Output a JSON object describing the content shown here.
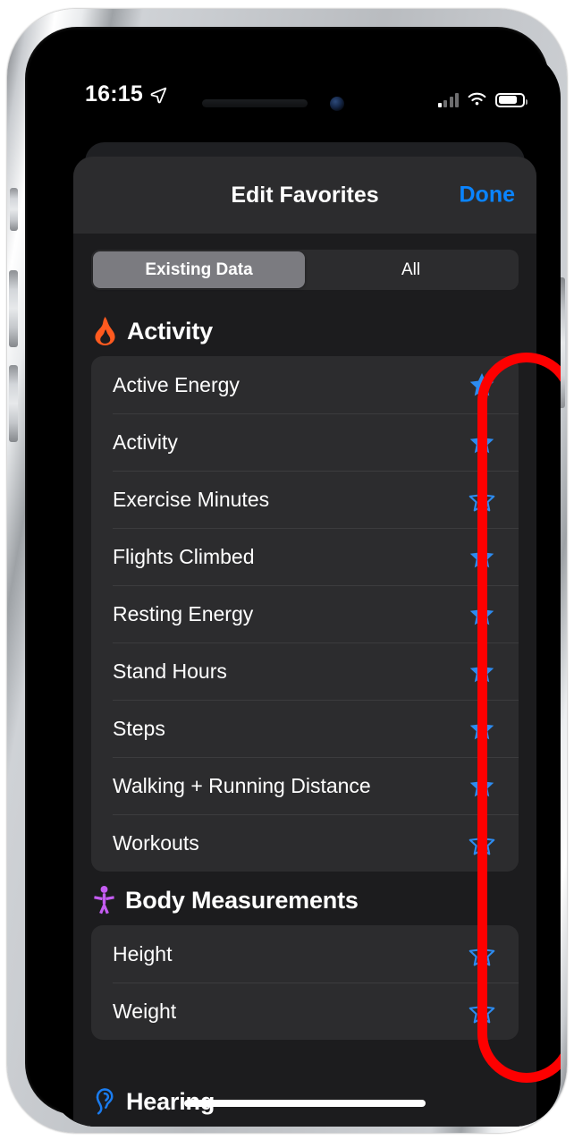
{
  "status_bar": {
    "time": "16:15",
    "location_icon": "location-arrow-icon",
    "cellular_icon": "cellular-bars-icon",
    "wifi_icon": "wifi-icon",
    "battery_icon": "battery-icon",
    "battery_level_pct": 70,
    "cellular_bars_active": 1
  },
  "nav": {
    "title": "Edit Favorites",
    "done_label": "Done",
    "done_color": "#0a84ff"
  },
  "segmented": {
    "options": [
      {
        "label": "Existing Data",
        "selected": true
      },
      {
        "label": "All",
        "selected": false
      }
    ]
  },
  "sections": [
    {
      "title": "Activity",
      "icon": "flame-icon",
      "icon_color": "#ff5a1f",
      "rows": [
        {
          "label": "Active Energy",
          "favorited": true
        },
        {
          "label": "Activity",
          "favorited": true
        },
        {
          "label": "Exercise Minutes",
          "favorited": false
        },
        {
          "label": "Flights Climbed",
          "favorited": true
        },
        {
          "label": "Resting Energy",
          "favorited": true
        },
        {
          "label": "Stand Hours",
          "favorited": true
        },
        {
          "label": "Steps",
          "favorited": true
        },
        {
          "label": "Walking + Running Distance",
          "favorited": true
        },
        {
          "label": "Workouts",
          "favorited": false
        }
      ]
    },
    {
      "title": "Body Measurements",
      "icon": "body-figure-icon",
      "icon_color": "#c45cf2",
      "rows": [
        {
          "label": "Height",
          "favorited": false
        },
        {
          "label": "Weight",
          "favorited": false
        }
      ]
    }
  ],
  "partial_section": {
    "title": "Hearing",
    "icon": "ear-icon",
    "icon_color": "#1a7cf0"
  },
  "annotation": {
    "shape": "rounded-oval-outline",
    "color": "#fe0000",
    "highlights": "favorite-star-column"
  },
  "colors": {
    "star_blue": "#2d8bf0",
    "sheet_bg": "#1c1c1e",
    "card_bg": "#2c2c2e",
    "navbar_bg": "#2c2c2e"
  }
}
